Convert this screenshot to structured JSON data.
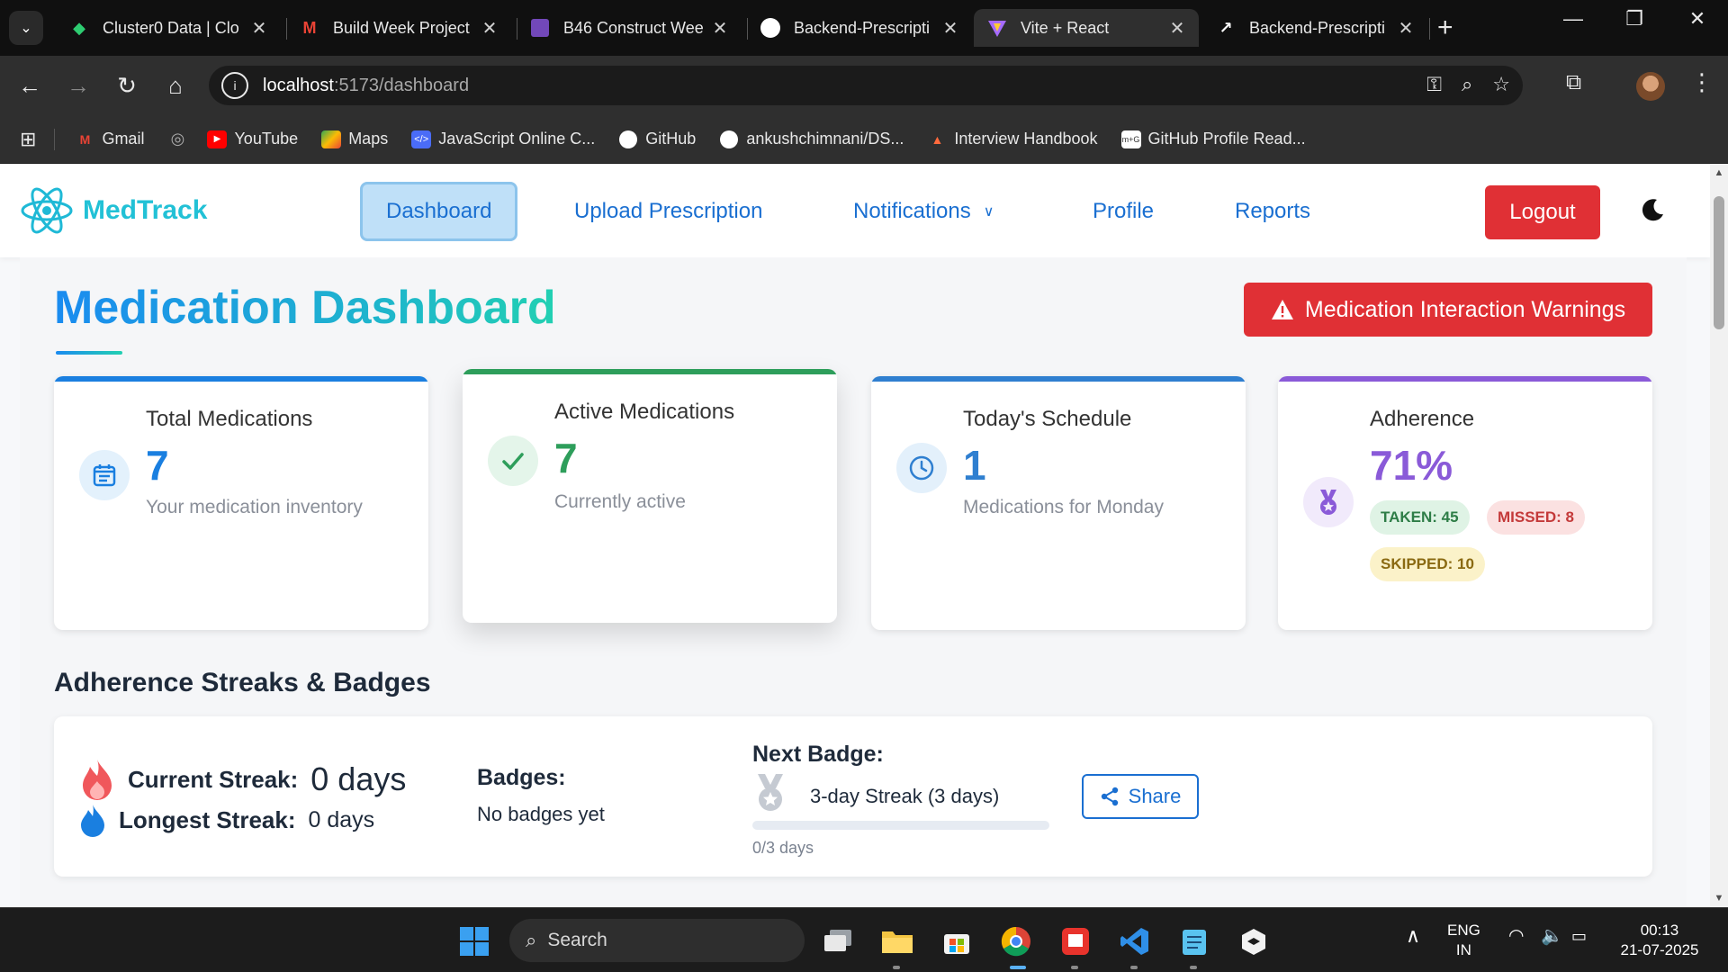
{
  "browser": {
    "tabs": [
      {
        "title": "Cluster0 Data | Clo",
        "icon": "mongodb-leaf-icon"
      },
      {
        "title": "Build Week Project",
        "icon": "gmail-icon"
      },
      {
        "title": "B46 Construct Wee",
        "icon": "forms-icon"
      },
      {
        "title": "Backend-Prescripti",
        "icon": "github-icon"
      },
      {
        "title": "Vite + React",
        "icon": "vite-icon",
        "active": true
      },
      {
        "title": "Backend-Prescripti",
        "icon": "render-icon"
      }
    ],
    "address": {
      "host": "localhost",
      "rest": ":5173/dashboard"
    },
    "bookmarks": [
      {
        "label": "Gmail",
        "icon": "gmail-icon"
      },
      {
        "label": "",
        "icon": "globe-icon"
      },
      {
        "label": "YouTube",
        "icon": "youtube-icon"
      },
      {
        "label": "Maps",
        "icon": "maps-icon"
      },
      {
        "label": "JavaScript Online C...",
        "icon": "code-icon"
      },
      {
        "label": "GitHub",
        "icon": "github-icon"
      },
      {
        "label": "ankushchimnani/DS...",
        "icon": "github-icon"
      },
      {
        "label": "Interview Handbook",
        "icon": "handbook-icon"
      },
      {
        "label": "GitHub Profile Read...",
        "icon": "readme-icon"
      }
    ]
  },
  "app": {
    "brand": "MedTrack",
    "nav": {
      "dashboard": "Dashboard",
      "upload": "Upload Prescription",
      "notifications": "Notifications",
      "profile": "Profile",
      "reports": "Reports",
      "logout": "Logout"
    },
    "title_part1": "Medication",
    "title_part2": "Dashboard",
    "warnings_button": "Medication Interaction Warnings",
    "cards": {
      "total": {
        "label": "Total Medications",
        "value": "7",
        "sub": "Your medication inventory",
        "color": "#1a7fe0"
      },
      "active": {
        "label": "Active Medications",
        "value": "7",
        "sub": "Currently active",
        "color": "#2e9e5b"
      },
      "schedule": {
        "label": "Today's Schedule",
        "value": "1",
        "sub": "Medications for Monday",
        "color": "#2f7fd0"
      },
      "adherence": {
        "label": "Adherence",
        "value": "71%",
        "color": "#8a5ad8",
        "taken": "TAKEN: 45",
        "missed": "MISSED: 8",
        "skipped": "SKIPPED: 10"
      }
    },
    "streaks": {
      "section_title": "Adherence Streaks & Badges",
      "current_label": "Current Streak:",
      "current_value": "0 days",
      "longest_label": "Longest Streak:",
      "longest_value": "0 days",
      "badges_label": "Badges:",
      "badges_empty": "No badges yet",
      "next_badge_label": "Next Badge:",
      "next_badge_name": "3-day Streak (3 days)",
      "progress_text": "0/3 days",
      "progress_fraction": 0,
      "share": "Share"
    }
  },
  "taskbar": {
    "search_placeholder": "Search",
    "lang_line1": "ENG",
    "lang_line2": "IN",
    "time": "00:13",
    "date": "21-07-2025"
  }
}
